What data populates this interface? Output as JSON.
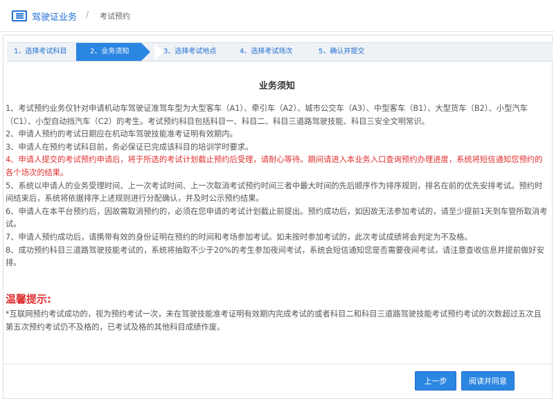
{
  "breadcrumb": {
    "main": "驾驶证业务",
    "separator": "/",
    "current": "考试预约"
  },
  "steps": [
    {
      "label": "1、选择考试科目",
      "active": false
    },
    {
      "label": "2、业务须知",
      "active": true
    },
    {
      "label": "3、选择考试地点",
      "active": false
    },
    {
      "label": "4、选择考试场次",
      "active": false
    },
    {
      "label": "5、确认并提交",
      "active": false
    }
  ],
  "notice": {
    "title": "业务须知",
    "items": [
      "1、考试预约业务仅针对申请机动车驾驶证准驾车型为大型客车（A1）、牵引车（A2）、城市公交车（A3）、中型客车（B1）、大型货车（B2）、小型汽车（C1）、小型自动挡汽车（C2）的考生。考试预约科目包括科目一、科目二、科目三道路驾驶技能、科目三安全文明常识。",
      "2、申请人预约的考试日期应在机动车驾驶技能准考证明有效期内。",
      "3、申请人在预约考试科目前，务必保证已完成该科目的培训学时要求。",
      "4、申请人提交的考试预约申请后，将于所选的考试计划截止预约后受理，请耐心等待。期间请进入本业务入口查询预约办理进度，系统将短信通知您预约的各个场次的结果。",
      "5、系统以申请人的业务受理时间、上一次考试时间、上一次取消考试预约时间三者中最大时间的先后顺序作为排序规则，排名在前的优先安排考试。预约时间结束后，系统将依据排序上述规则进行分配确认，并及时公示预约结果。",
      "6、申请人在本平台预约后，因故需取消预约的，必须在您申请的考试计划截止前提出。预约成功后，如因故无法参加考试的，请至少提前1天到车管所取消考试。",
      "7、申请人预约成功后，请携带有效的身份证明在预约的时间和考场参加考试。如未按时参加考试的，此次考试成绩将会判定为不及格。",
      "8、成功预约科目三道路驾驶技能考试的，系统将抽取不少于20%的考生参加夜间考试，系统会短信通知您是否需要夜间考试，请注意查收信息并提前做好安排。"
    ],
    "red_index": 3
  },
  "tips": {
    "title": "温馨提示:",
    "text": "*互联网预约考试成功的，视为预约考试一次，未在驾驶技能准考证明有效期内完成考试的或者科目二和科目三道路驾驶技能考试预约考试的次数超过五次且第五次预约考试仍不及格的，已考试及格的其他科目成绩作废。"
  },
  "buttons": {
    "prev": "上一步",
    "agree": "阅读并同意"
  },
  "colors": {
    "accent": "#2b86e2",
    "warning": "#e03030"
  }
}
